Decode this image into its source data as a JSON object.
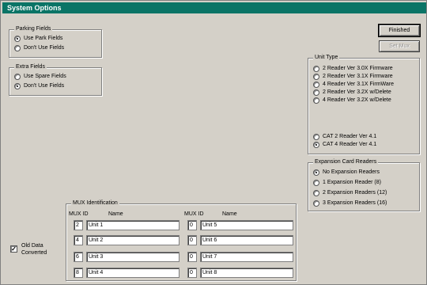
{
  "window": {
    "title": "System Options"
  },
  "buttons": {
    "finished": "Finished",
    "set_mux": "Set Mux"
  },
  "parking_fields": {
    "legend": "Parking Fields",
    "options": [
      {
        "label": "Use Park Fields",
        "checked": true
      },
      {
        "label": "Don't Use Fields",
        "checked": false
      }
    ]
  },
  "extra_fields": {
    "legend": "Extra Fields",
    "options": [
      {
        "label": "Use Spare Fields",
        "checked": false
      },
      {
        "label": "Don't Use Fields",
        "checked": true
      }
    ]
  },
  "unit_type": {
    "legend": "Unit Type",
    "options": [
      {
        "label": "2 Reader Ver 3.0X Firmware",
        "checked": false
      },
      {
        "label": "2 Reader Ver 3.1X Firmware",
        "checked": false
      },
      {
        "label": "4 Reader Ver 3.1X FirmWare",
        "checked": false
      },
      {
        "label": "2 Reader Ver 3.2X w/Delete",
        "checked": false
      },
      {
        "label": "4 Reader Ver 3.2X w/Delete",
        "checked": false
      },
      {
        "label": "CAT 2 Reader Ver 4.1",
        "checked": false
      },
      {
        "label": "CAT 4 Reader Ver 4.1",
        "checked": true
      }
    ]
  },
  "expansion": {
    "legend": "Expansion Card Readers",
    "options": [
      {
        "label": "No Expansion Readers",
        "checked": true
      },
      {
        "label": "1 Expansion Reader (8)",
        "checked": false
      },
      {
        "label": "2 Expansion Readers (12)",
        "checked": false
      },
      {
        "label": "3 Expansion Readers (16)",
        "checked": false
      }
    ]
  },
  "mux": {
    "legend": "MUX Identification",
    "col_id": "MUX ID",
    "col_name": "Name",
    "left": [
      {
        "id": "2",
        "name": "Unit 1"
      },
      {
        "id": "4",
        "name": "Unit 2"
      },
      {
        "id": "6",
        "name": "Unit 3"
      },
      {
        "id": "8",
        "name": "Unit 4"
      }
    ],
    "right": [
      {
        "id": "0",
        "name": "Unit 5"
      },
      {
        "id": "0",
        "name": "Unit 6"
      },
      {
        "id": "0",
        "name": "Unit 7"
      },
      {
        "id": "0",
        "name": "Unit 8"
      }
    ]
  },
  "old_data": {
    "label_line1": "Old Data",
    "label_line2": "Converted",
    "checked": true,
    "mark": "✓"
  }
}
